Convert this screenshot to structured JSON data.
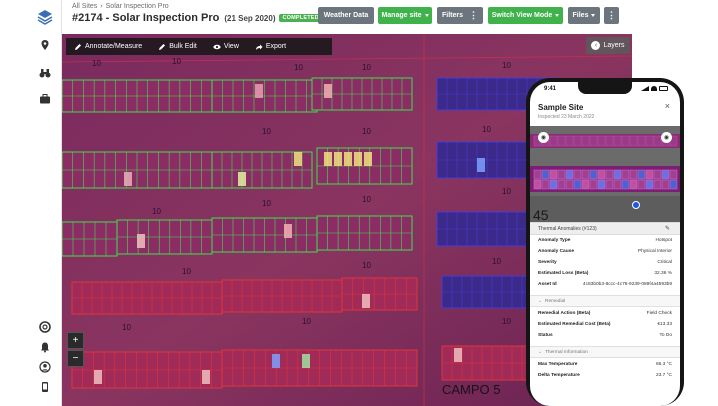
{
  "header": {
    "breadcrumb": [
      "All Sites",
      "Solar Inspection Pro"
    ],
    "title": "#2174 - Solar Inspection Pro",
    "date": "(21 Sep 2020)",
    "status": "COMPLETED",
    "buttons": {
      "weather": "Weather Data",
      "manage": "Manage site",
      "filters": "Filters",
      "switch_view": "Switch View Mode",
      "files": "Files"
    }
  },
  "toolbar": {
    "annotate": "Annotate/Measure",
    "bulk_edit": "Bulk Edit",
    "view": "View",
    "export": "Export"
  },
  "map": {
    "layers": "Layers",
    "zoom_in": "+",
    "zoom_out": "−",
    "row_labels": [
      "10",
      "10",
      "10",
      "10",
      "10",
      "10",
      "10",
      "10",
      "10",
      "10",
      "10",
      "10",
      "10",
      "10",
      "10",
      "10",
      "10",
      "10",
      "10"
    ],
    "campo_label": "CAMPO 5"
  },
  "phone": {
    "time": "9:41",
    "site_title": "Sample Site",
    "inspected": "Inspected 23 March 2022",
    "map_label": "45",
    "anomalies_title": "Thermal Anomalies (#123)",
    "rows": [
      {
        "k": "Anomaly Type",
        "v": "Hotspot"
      },
      {
        "k": "Anomaly Cause",
        "v": "Physical Interior"
      },
      {
        "k": "Severity",
        "v": "Critical"
      },
      {
        "k": "Estimated Loss (Beta)",
        "v": "32.36 %"
      },
      {
        "k": "Asset Id",
        "v": "4c83b0b3-8ccc-4c76-9239-089f4a4593b9"
      }
    ],
    "remedial_section": "Remedial",
    "remedial_rows": [
      {
        "k": "Remedial Action (Beta)",
        "v": "Field Check"
      },
      {
        "k": "Estimated Remedial Cost (Beta)",
        "v": "€13.33"
      },
      {
        "k": "Status",
        "v": "To Do"
      }
    ],
    "thermal_section": "Thermal Information",
    "thermal_rows": [
      {
        "k": "Max Temperature",
        "v": "66.3 °C"
      },
      {
        "k": "Delta Temperature",
        "v": "23.7 °C"
      }
    ]
  },
  "colors": {
    "accent_green": "#3fb24c",
    "gray_button": "#6c757d",
    "thermal_base": "#5a1c52",
    "panel_outline_green": "#3ee04a",
    "panel_outline_red": "#e0353a"
  }
}
